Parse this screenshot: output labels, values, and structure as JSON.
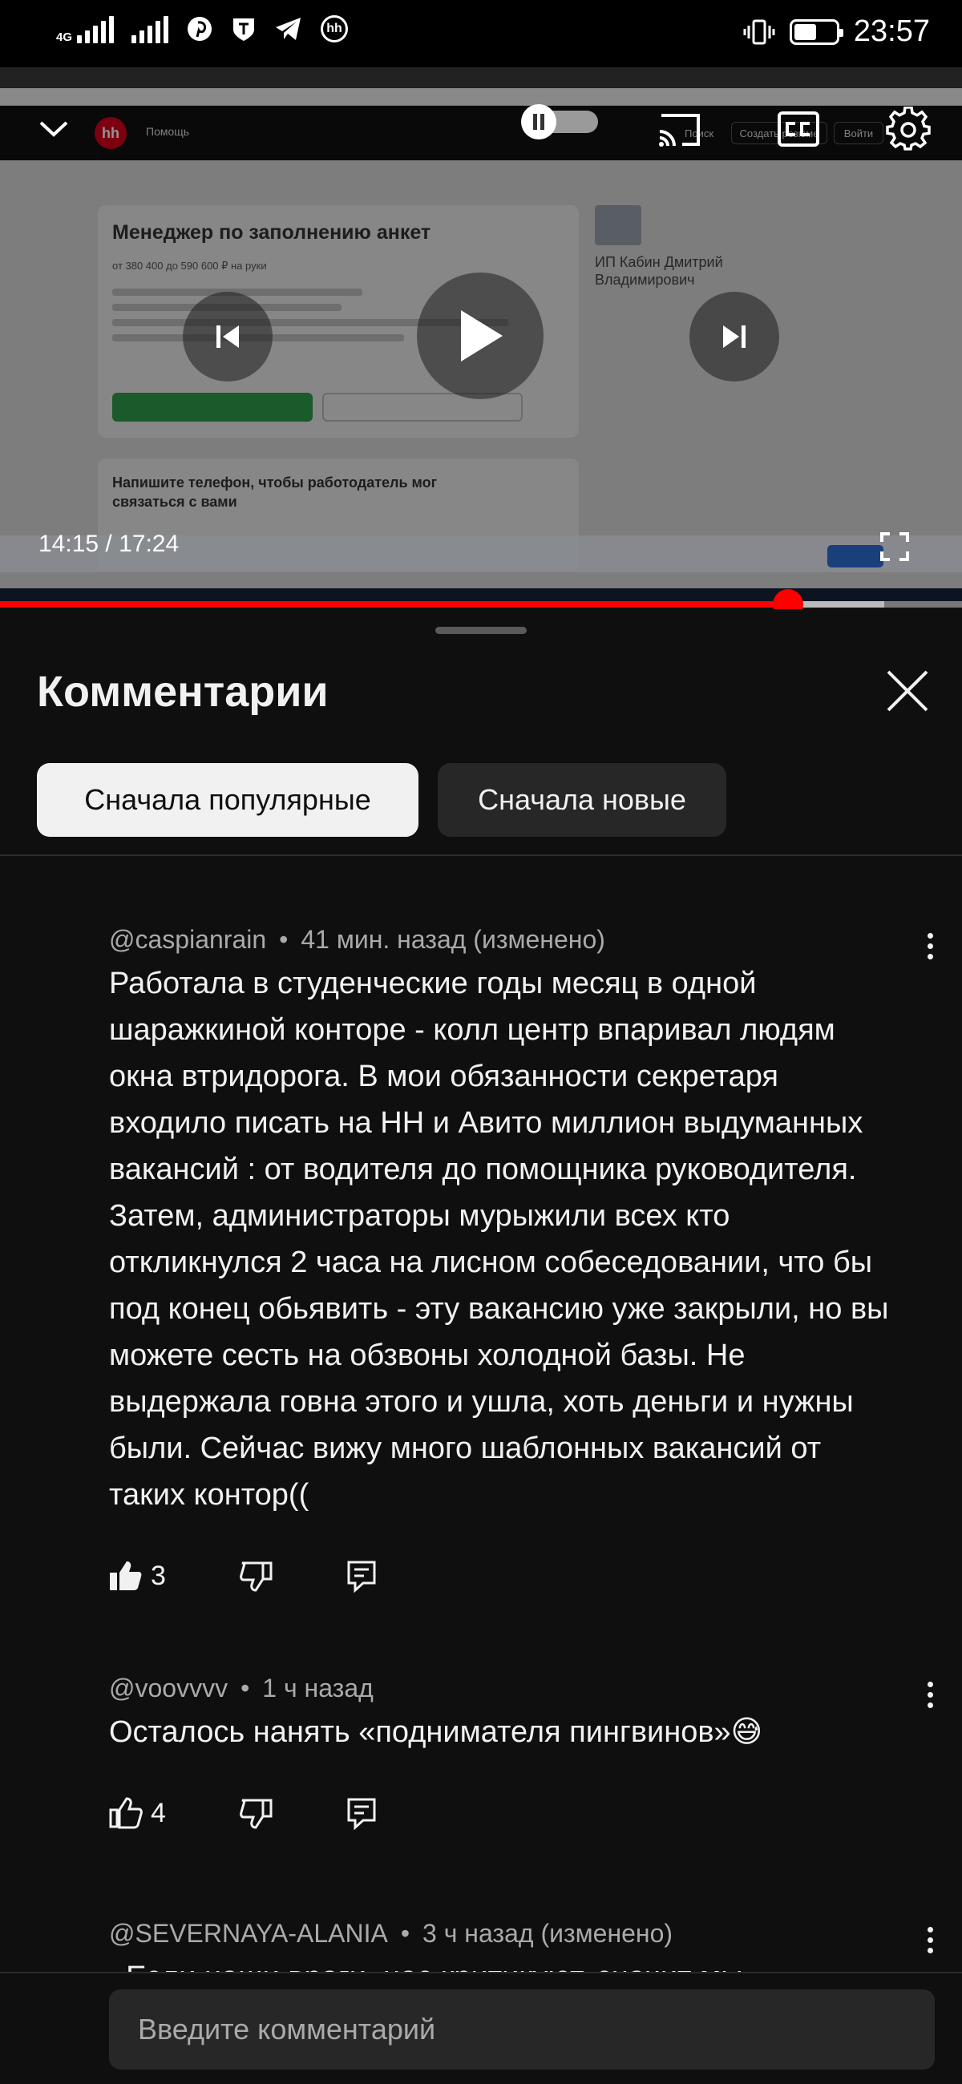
{
  "status_bar": {
    "network_type": "4G",
    "app_badge": "hh",
    "time": "23:57",
    "battery_level": 0.55
  },
  "video": {
    "current_time": "14:15",
    "separator": " / ",
    "duration": "17:24",
    "progress_fraction": 0.819,
    "buffer_fraction": 0.1,
    "screen": {
      "logo": "hh",
      "nav_help": "Помощь",
      "nav_search": "Поиск",
      "nav_resume": "Создать резюме",
      "nav_login": "Войти",
      "vacancy_title": "Менеджер по заполнению анкет",
      "salary": "от 380 400 до 590 600 ₽ на руки",
      "employer": "ИП Кабин Дмитрий Владимирович",
      "callout": "Напишите телефон, чтобы работодатель мог связаться с вами"
    }
  },
  "comments_sheet": {
    "title": "Комментарии",
    "sort_chips": [
      {
        "label": "Сначала популярные",
        "active": true
      },
      {
        "label": "Сначала новые",
        "active": false
      }
    ],
    "comments": [
      {
        "author": "@caspianrain",
        "time": "41 мин. назад (изменено)",
        "text": "Работала в студенческие годы месяц в одной шаражкиной конторе - колл центр впаривал людям окна втридорога. В мои обязанности секретаря входило писать на НН и Авито миллион выдуманных вакансий : от водителя до помощника руководителя. Затем, администраторы мурыжили всех кто откликнулся 2 часа на лисном собеседовании, что бы под конец обьявить - эту вакансию уже закрыли, но вы можете сесть на обзвоны холодной базы. Не выдержала говна этого и ушла, хоть деньги и нужны были. Сейчас вижу много шаблонных вакансий от таких контор((",
        "likes": "3",
        "liked": true
      },
      {
        "author": "@voovvvv",
        "time": "1 ч назад",
        "text": "Осталось нанять «поднимателя пингвинов»😅",
        "likes": "4",
        "liked": false
      },
      {
        "author": "@SEVERNAYA-ALANIA",
        "time": "3 ч назад (изменено)",
        "text": "«Если наши враги, нас критикуют, значит мы",
        "likes": "",
        "liked": false
      }
    ],
    "input_placeholder": "Введите комментарий"
  }
}
